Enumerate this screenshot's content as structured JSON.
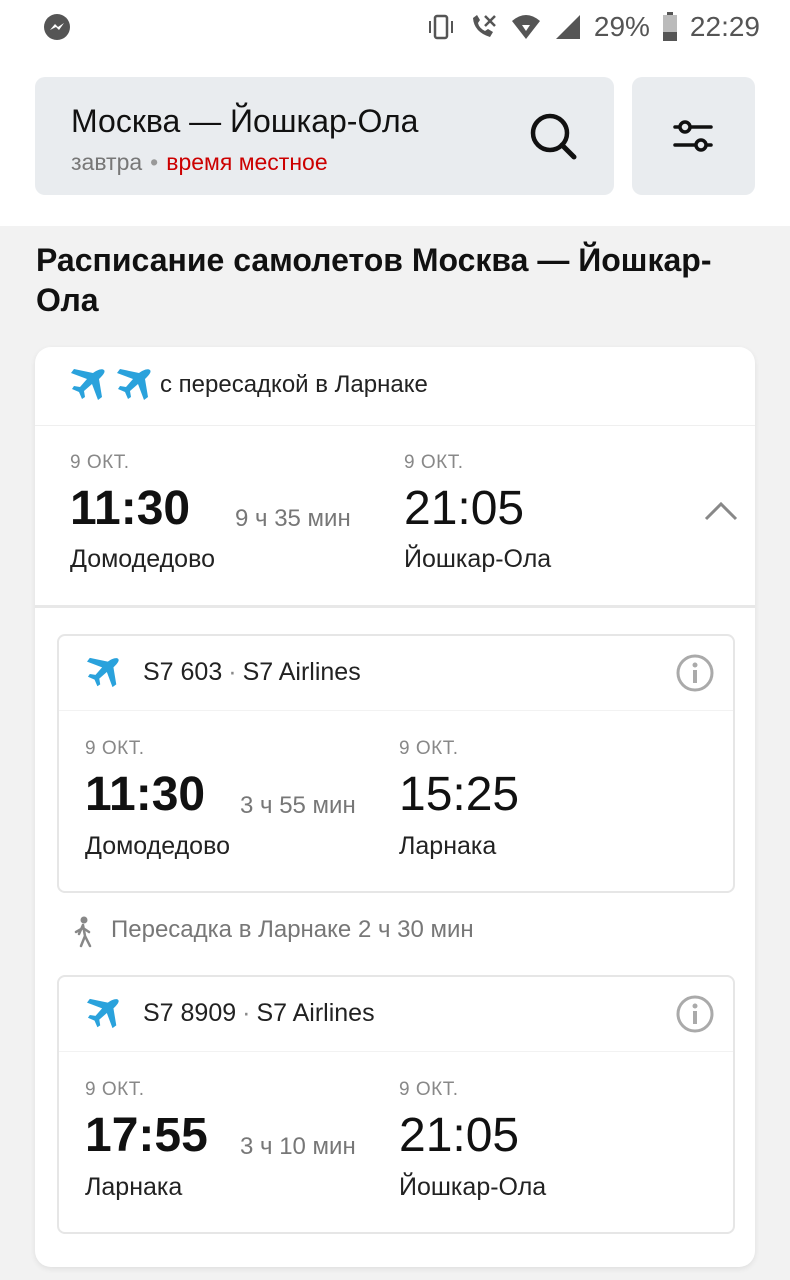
{
  "status_bar": {
    "battery": "29%",
    "time": "22:29",
    "icons": [
      "messenger-icon",
      "vibrate-icon",
      "wifi-calling-icon",
      "wifi-icon",
      "signal-icon",
      "battery-icon"
    ]
  },
  "search": {
    "route": "Москва — Йошкар-Ола",
    "date": "завтра",
    "separator": "•",
    "time_mode": "время местное",
    "time_mode_color": "#cc0000"
  },
  "page": {
    "title": "Расписание самолетов Москва — Йошкар-Ола"
  },
  "trip": {
    "transfer_label": "с пересадкой в Ларнаке",
    "departure": {
      "date": "9 ОКТ.",
      "time": "11:30",
      "place": "Домодедово"
    },
    "duration": "9 ч 35 мин",
    "arrival": {
      "date": "9 ОКТ.",
      "time": "21:05",
      "place": "Йошкар-Ола"
    }
  },
  "segments": [
    {
      "flight": "S7 603",
      "airline": "S7 Airlines",
      "departure": {
        "date": "9 ОКТ.",
        "time": "11:30",
        "place": "Домодедово"
      },
      "duration": "3 ч 55 мин",
      "arrival": {
        "date": "9 ОКТ.",
        "time": "15:25",
        "place": "Ларнака"
      }
    },
    {
      "flight": "S7 8909",
      "airline": "S7 Airlines",
      "departure": {
        "date": "9 ОКТ.",
        "time": "17:55",
        "place": "Ларнака"
      },
      "duration": "3 ч 10 мин",
      "arrival": {
        "date": "9 ОКТ.",
        "time": "21:05",
        "place": "Йошкар-Ола"
      }
    }
  ],
  "layover": {
    "label": "Пересадка в Ларнаке",
    "duration": "2 ч 30 мин"
  },
  "colors": {
    "plane": "#2aa2dc",
    "accent_red": "#cc0000"
  }
}
